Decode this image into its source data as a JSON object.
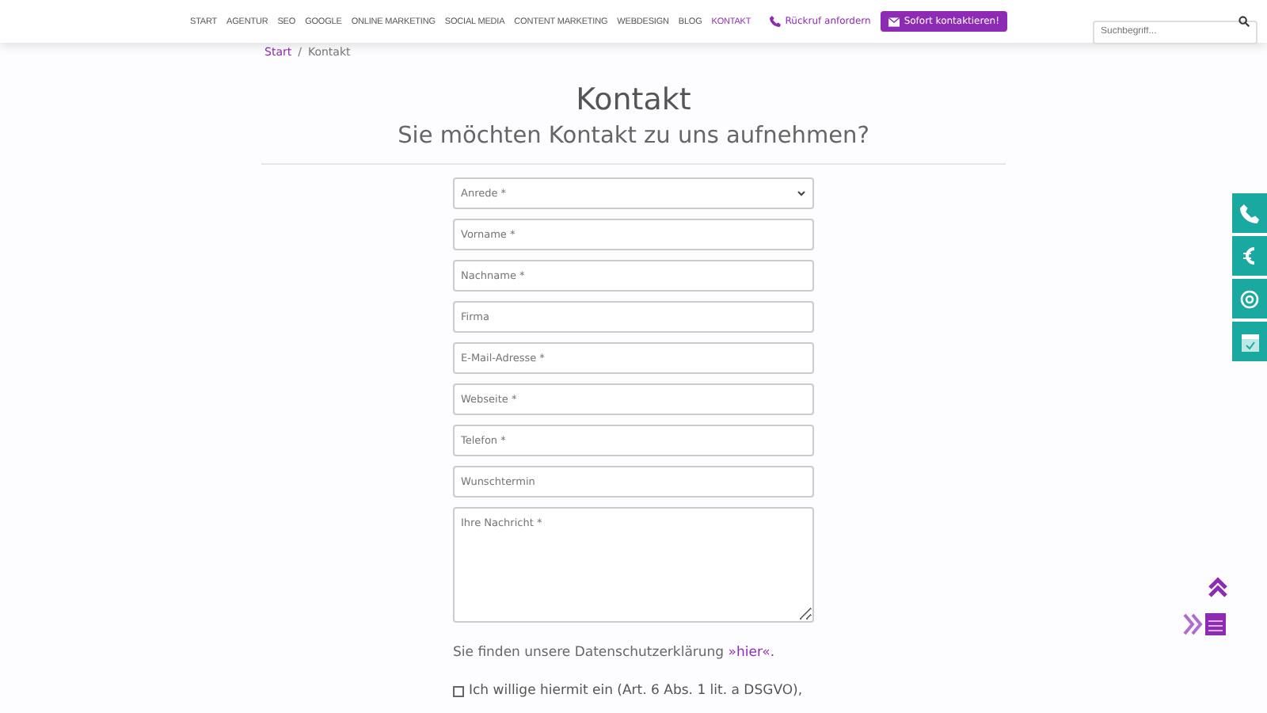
{
  "nav": {
    "items": [
      {
        "label": "START",
        "selected": false
      },
      {
        "label": "AGENTUR",
        "selected": false
      },
      {
        "label": "SEO",
        "selected": false
      },
      {
        "label": "GOOGLE",
        "selected": false
      },
      {
        "label": "ONLINE MARKETING",
        "selected": false
      },
      {
        "label": "SOCIAL MEDIA",
        "selected": false
      },
      {
        "label": "CONTENT MARKETING",
        "selected": false
      },
      {
        "label": "WEBDESIGN",
        "selected": false
      },
      {
        "label": "BLOG",
        "selected": false
      },
      {
        "label": "KONTAKT",
        "selected": true
      }
    ],
    "callback": "Rückruf anfordern",
    "contact_button": "Sofort kontaktieren!",
    "search": {
      "placeholder": "Suchbegriff..."
    }
  },
  "breadcrumb": {
    "items": [
      "Start",
      "Kontakt"
    ],
    "separator": "/"
  },
  "title": "Kontakt",
  "subtitle": "Sie möchten Kontakt zu uns aufnehmen?",
  "form": {
    "fields": [
      {
        "kind": "select",
        "placeholder": "Anrede *"
      },
      {
        "kind": "input",
        "placeholder": "Vorname *"
      },
      {
        "kind": "input",
        "placeholder": "Nachname *"
      },
      {
        "kind": "input",
        "placeholder": "Firma"
      },
      {
        "kind": "input",
        "placeholder": "E-Mail-Adresse *"
      },
      {
        "kind": "input",
        "placeholder": "Webseite *"
      },
      {
        "kind": "input",
        "placeholder": "Telefon *"
      },
      {
        "kind": "input",
        "placeholder": "Wunschtermin"
      },
      {
        "kind": "textarea",
        "placeholder": "Ihre Nachricht *"
      }
    ],
    "privacy": "Sie finden unsere Datenschutzerklärung",
    "privacy_link": "»hier«.",
    "consent": {
      "label": "Ich willige hiermit ein (Art. 6 Abs. 1 lit. a DSGVO),",
      "checked": false
    }
  }
}
